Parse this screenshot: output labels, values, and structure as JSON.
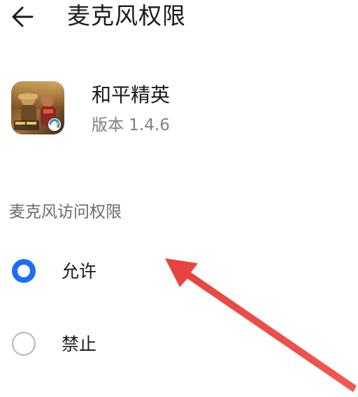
{
  "header": {
    "title": "麦克风权限",
    "back_icon": "arrow-left-icon"
  },
  "app": {
    "name": "和平精英",
    "version": "版本 1.4.6",
    "icon": "game-app-icon"
  },
  "permission": {
    "section_title": "麦克风访问权限",
    "options": [
      {
        "label": "允许",
        "selected": true
      },
      {
        "label": "禁止",
        "selected": false
      }
    ]
  },
  "colors": {
    "accent": "#1e6ef5",
    "annotation": "#e8413c"
  }
}
